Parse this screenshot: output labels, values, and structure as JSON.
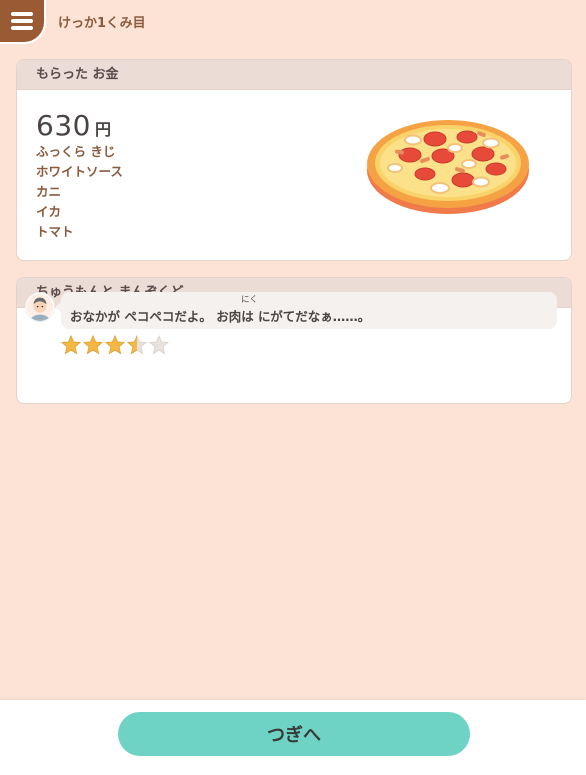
{
  "header": {
    "menu_icon": "hamburger-menu-icon",
    "title": "けっか1くみ目"
  },
  "money_card": {
    "heading": "もらった お金",
    "price_value": "630",
    "price_unit": "円",
    "ingredients": [
      "ふっくら きじ",
      "ホワイトソース",
      "カニ",
      "イカ",
      "トマト"
    ],
    "image": "pizza-illustration"
  },
  "review_card": {
    "heading": "ちゅうもんと まんぞくど",
    "avatar_icon": "customer-avatar-icon",
    "comment": "おなかが ペコペコだよ。 お肉は にがてだなぁ……。",
    "ruby": "にく",
    "rating": 3.5,
    "rating_max": 5
  },
  "footer": {
    "next_label": "つぎへ"
  },
  "colors": {
    "background": "#fde3d6",
    "menu": "#9a5a34",
    "accent_text": "#8b5a3c",
    "button": "#6ed2c4",
    "star": "#f4b942",
    "star_empty": "#e8e2de"
  }
}
